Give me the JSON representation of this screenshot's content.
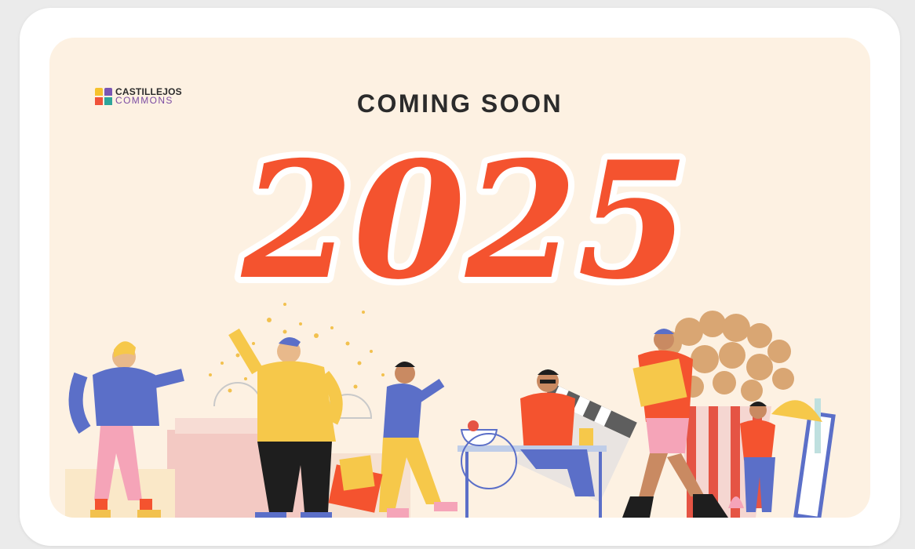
{
  "logo": {
    "line1": "CASTILLEJOS",
    "line2": "COMMONS",
    "icon": "four-square-bags-icon"
  },
  "headline": "COMING SOON",
  "year": "2025",
  "colors": {
    "page_background": "#ebebeb",
    "card": "#ffffff",
    "banner": "#fdf1e2",
    "year_red": "#f4532f",
    "headline_text": "#2b2b2b",
    "logo_purple": "#7c4da3"
  },
  "illustration": {
    "icon": "shoppers-mall-scene-illustration"
  }
}
